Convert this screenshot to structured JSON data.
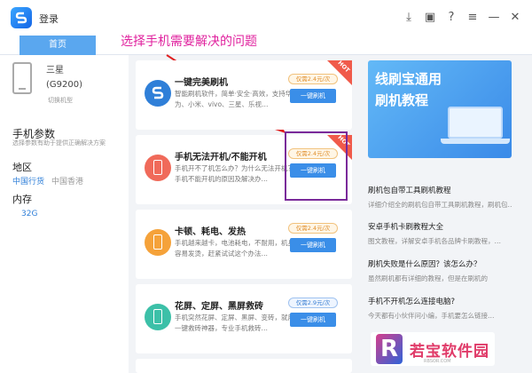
{
  "app": {
    "login": "登录"
  },
  "tabs": {
    "home": "首页"
  },
  "annotation": "选择手机需要解决的问题",
  "device": {
    "brand": "三星",
    "model": "(G9200)",
    "switch": "切换机型"
  },
  "params": {
    "title": "手机参数",
    "subtitle": "选择参数有助于提供正确解决方案"
  },
  "region": {
    "title": "地区",
    "options": [
      "中国行货",
      "中国香港"
    ]
  },
  "memory": {
    "title": "内存",
    "value": "32G"
  },
  "cards": [
    {
      "title": "一键完美刷机",
      "desc": "智能刷机软件，简单·安全·高效，支持华为、小米、vivo、三星、乐视…",
      "price": "仅需2.4元/次",
      "button": "一键刷机",
      "hot": "HOT"
    },
    {
      "title": "手机无法开机/不能开机",
      "desc": "手机开不了机怎么办？为什么无法开机？手机不能开机的原因及解决办…",
      "price": "仅需2.4元/次",
      "button": "一键刷机",
      "hot": "HOT"
    },
    {
      "title": "卡顿、耗电、发热",
      "desc": "手机越来越卡，电池耗电，不耐用，机身容易发烫，赶紧试试这个办法…",
      "price": "仅需2.4元/次",
      "button": "一键刷机"
    },
    {
      "title": "花屏、定屏、黑屏救砖",
      "desc": "手机突然花屏、定屏、黑屏、变砖，就用一键救砖神器，专业手机救砖…",
      "price": "仅需2.9元/次",
      "button": "一键刷机"
    }
  ],
  "banner": {
    "line1": "线刷宝通用",
    "line2": "刷机教程"
  },
  "articles": [
    {
      "title": "刷机包自带工具刷机教程",
      "desc": "详细介绍全的刷机包自带工具刷机教程，刷机包…"
    },
    {
      "title": "安卓手机卡刷教程大全",
      "desc": "图文教程，详解安卓手机各品牌卡刷教程，…"
    },
    {
      "title": "刷机失败是什么原因？该怎么办？",
      "desc": "虽然刷机都有详细的教程，但是在刷机的"
    },
    {
      "title": "手机不开机怎么连接电脑?",
      "desc": "今天都有小伙伴问小编，手机要怎么链接…"
    }
  ],
  "watermark": {
    "name": "若宝软件园",
    "url": "RBSOR.COM"
  },
  "colors": {
    "accent": "#3a8ee8",
    "annotation": "#e0229e",
    "hot": "#f05a4a",
    "highlight": "#7a2a9a"
  },
  "icons": [
    "download-icon",
    "briefcase-icon",
    "help-icon",
    "menu-icon",
    "minimize-icon",
    "close-icon"
  ]
}
